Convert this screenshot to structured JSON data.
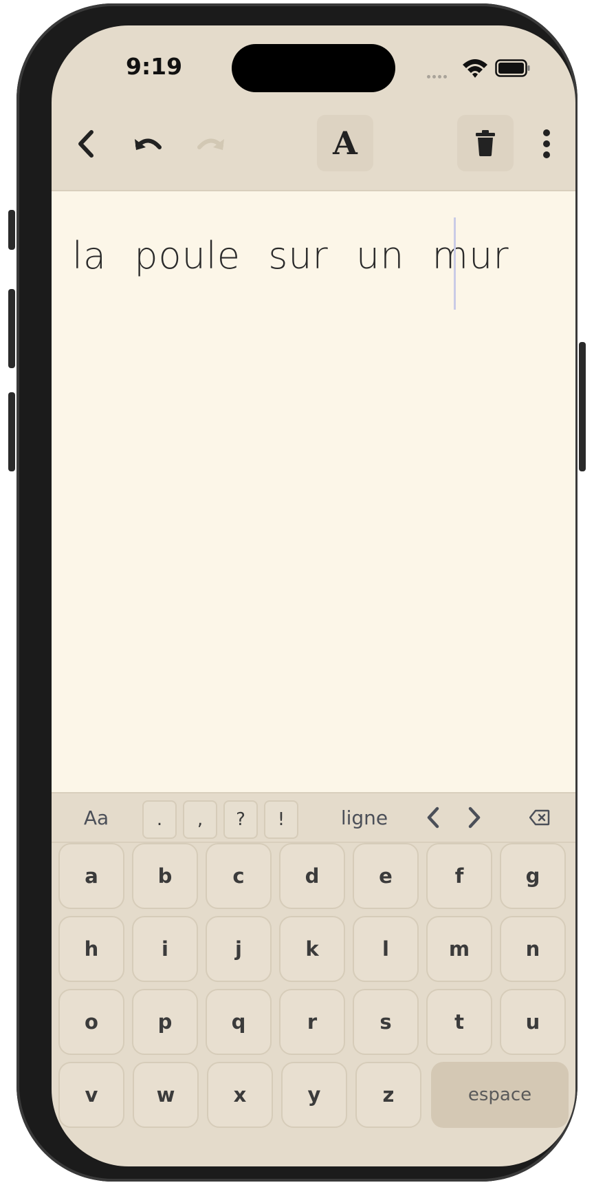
{
  "status_bar": {
    "time": "9:19"
  },
  "toolbar": {
    "back_icon": "chevron-left-icon",
    "undo_icon": "undo-icon",
    "redo_icon": "redo-icon",
    "font_label": "A",
    "delete_icon": "trash-icon",
    "more_icon": "more-vertical-icon"
  },
  "editor": {
    "text": "la poule sur un mur"
  },
  "keyboard_bar": {
    "case_label": "Aa",
    "punctuation": [
      ".",
      ",",
      "?",
      "!"
    ],
    "line_label": "ligne",
    "prev_icon": "chevron-left-icon",
    "next_icon": "chevron-right-icon",
    "backspace_icon": "backspace-icon"
  },
  "keyboard": {
    "rows": [
      [
        "a",
        "b",
        "c",
        "d",
        "e",
        "f",
        "g"
      ],
      [
        "h",
        "i",
        "j",
        "k",
        "l",
        "m",
        "n"
      ],
      [
        "o",
        "p",
        "q",
        "r",
        "s",
        "t",
        "u"
      ],
      [
        "v",
        "w",
        "x",
        "y",
        "z"
      ]
    ],
    "space_label": "espace"
  },
  "colors": {
    "frame": "#1b1b1b",
    "background": "#e4dbcb",
    "editor_bg": "#fcf6e8",
    "space_key": "#d4c8b4"
  }
}
